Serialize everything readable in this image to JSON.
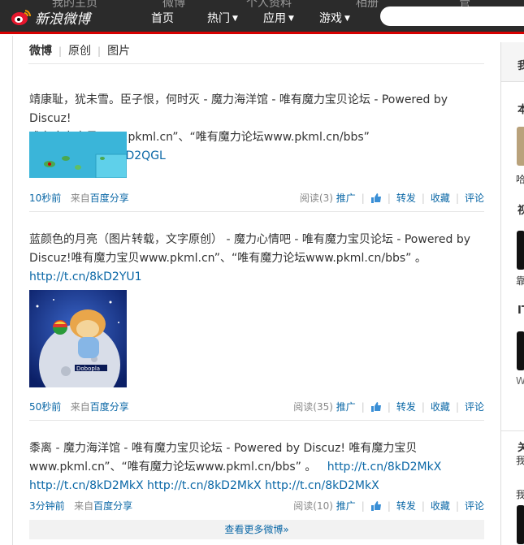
{
  "topbar": {
    "ghost_items": [
      "我的主页",
      "微博",
      "个人资料",
      "相册",
      "管"
    ],
    "logo_text": "新浪微博",
    "nav": [
      "首页",
      "热门",
      "应用",
      "游戏"
    ]
  },
  "tabs": [
    "微博",
    "原创",
    "图片"
  ],
  "feed": [
    {
      "line1": "靖康耻，犹未雪。臣子恨，何时灭 - 魔力海洋馆 - 唯有魔力宝贝论坛 - Powered by Discuz!",
      "line2": "唯有魔力宝贝www.pkml.cn”、“唯有魔力论坛www.pkml.cn/bbs” 。",
      "link": "http://t.cn/8kD2QGL",
      "time": "10秒前",
      "from": "来自",
      "source": "百度分享",
      "reads": "阅读(3)",
      "promote": "推广",
      "repost": "转发",
      "fav": "收藏",
      "comment": "评论"
    },
    {
      "line1": "蓝颜色的月亮（图片转载，文字原创） - 魔力心情吧 - 唯有魔力宝贝论坛 - Powered by",
      "line2": "Discuz!唯有魔力宝贝www.pkml.cn”、“唯有魔力论坛www.pkml.cn/bbs” 。",
      "link": "http://t.cn/8kD2YU1",
      "time": "50秒前",
      "from": "来自",
      "source": "百度分享",
      "reads": "阅读(35)",
      "promote": "推广",
      "repost": "转发",
      "fav": "收藏",
      "comment": "评论"
    },
    {
      "line1": "黍离 - 魔力海洋馆 - 唯有魔力宝贝论坛 - Powered by Discuz! 唯有魔力宝贝",
      "line2": "www.pkml.cn”、“唯有魔力论坛www.pkml.cn/bbs” 。",
      "link": "http://t.cn/8kD2MkX",
      "line3": "http://t.cn/8kD2MkX http://t.cn/8kD2MkX http://t.cn/8kD2MkX",
      "time": "3分钟前",
      "from": "来自",
      "source": "百度分享",
      "reads": "阅读(10)",
      "promote": "推广",
      "repost": "转发",
      "fav": "收藏",
      "comment": "评论"
    }
  ],
  "thumb2_caption": "Dobopla",
  "more_label": "查看更多微博»",
  "sidebar": {
    "labels": [
      "我",
      "本",
      "哈",
      "视",
      "靠",
      "IT",
      "W",
      "关",
      "我",
      "我"
    ]
  },
  "colors": {
    "link": "#0a67a6",
    "accent_red": "#d70000",
    "nav_bg": "#2b2b2b"
  }
}
